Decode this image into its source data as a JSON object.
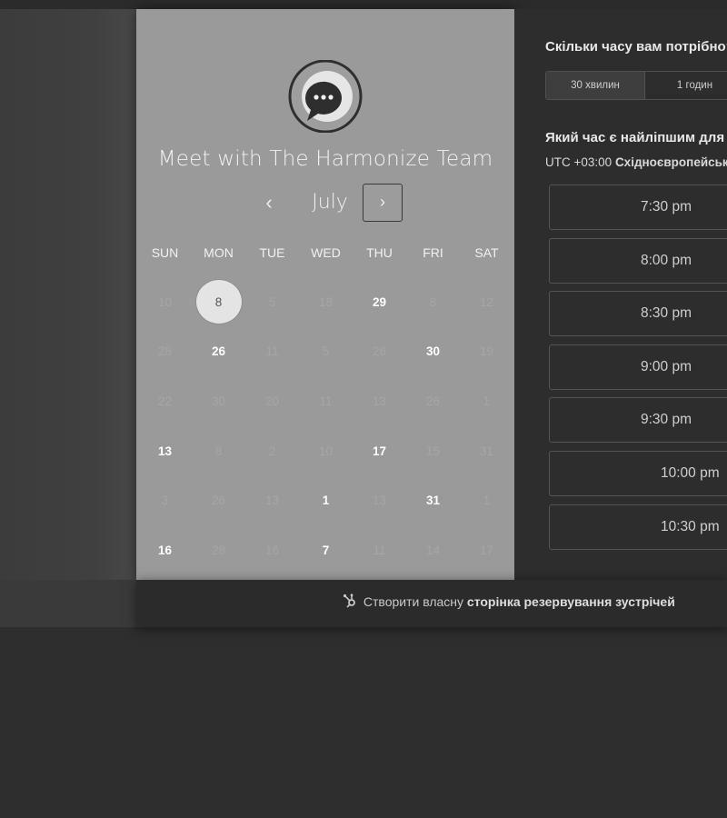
{
  "calendar": {
    "title": "Meet with The Harmonize Team",
    "month": "July",
    "prev_icon": "‹",
    "next_icon": "›",
    "weekdays": [
      "SUN",
      "MON",
      "TUE",
      "WED",
      "THU",
      "FRI",
      "SAT"
    ],
    "weeks": [
      [
        {
          "d": "10",
          "s": "muted"
        },
        {
          "d": "8",
          "s": "selected"
        },
        {
          "d": "5",
          "s": "muted"
        },
        {
          "d": "18",
          "s": "muted"
        },
        {
          "d": "29",
          "s": "available"
        },
        {
          "d": "8",
          "s": "muted"
        },
        {
          "d": "12",
          "s": "muted"
        }
      ],
      [
        {
          "d": "28",
          "s": "muted"
        },
        {
          "d": "26",
          "s": "available"
        },
        {
          "d": "11",
          "s": "muted"
        },
        {
          "d": "5",
          "s": "muted"
        },
        {
          "d": "26",
          "s": "muted"
        },
        {
          "d": "30",
          "s": "available"
        },
        {
          "d": "19",
          "s": "muted"
        }
      ],
      [
        {
          "d": "22",
          "s": "muted"
        },
        {
          "d": "30",
          "s": "muted"
        },
        {
          "d": "20",
          "s": "muted"
        },
        {
          "d": "11",
          "s": "muted"
        },
        {
          "d": "13",
          "s": "muted"
        },
        {
          "d": "26",
          "s": "muted"
        },
        {
          "d": "1",
          "s": "muted"
        }
      ],
      [
        {
          "d": "13",
          "s": "available"
        },
        {
          "d": "8",
          "s": "muted"
        },
        {
          "d": "2",
          "s": "muted"
        },
        {
          "d": "10",
          "s": "muted"
        },
        {
          "d": "17",
          "s": "available"
        },
        {
          "d": "15",
          "s": "muted"
        },
        {
          "d": "31",
          "s": "muted"
        }
      ],
      [
        {
          "d": "3",
          "s": "muted"
        },
        {
          "d": "26",
          "s": "muted"
        },
        {
          "d": "13",
          "s": "muted"
        },
        {
          "d": "1",
          "s": "available"
        },
        {
          "d": "13",
          "s": "muted"
        },
        {
          "d": "31",
          "s": "available"
        },
        {
          "d": "1",
          "s": "muted"
        }
      ],
      [
        {
          "d": "16",
          "s": "available"
        },
        {
          "d": "28",
          "s": "muted"
        },
        {
          "d": "16",
          "s": "muted"
        },
        {
          "d": "7",
          "s": "available"
        },
        {
          "d": "11",
          "s": "muted"
        },
        {
          "d": "14",
          "s": "muted"
        },
        {
          "d": "17",
          "s": "muted"
        }
      ]
    ]
  },
  "booking": {
    "duration_question": "Скільки часу вам потрібно?",
    "durations": [
      {
        "label": "30 хвилин",
        "active": true
      },
      {
        "label": "1 годин",
        "active": false
      }
    ],
    "time_question": "Який час є найліпшим для вас?",
    "tz_offset": "UTC +03:00",
    "tz_name": "Східноєвропейський час",
    "slots": [
      "7:30 pm",
      "8:00 pm",
      "8:30 pm",
      "9:00 pm",
      "9:30 pm",
      "10:00 pm",
      "10:30 pm"
    ]
  },
  "footer": {
    "prefix": "Створити власну",
    "link": "сторінка резервування зустрічей"
  },
  "colors": {
    "panel_left": "#9a9a9a",
    "panel_right": "#2d2d2d",
    "background": "#2e2e2e"
  }
}
